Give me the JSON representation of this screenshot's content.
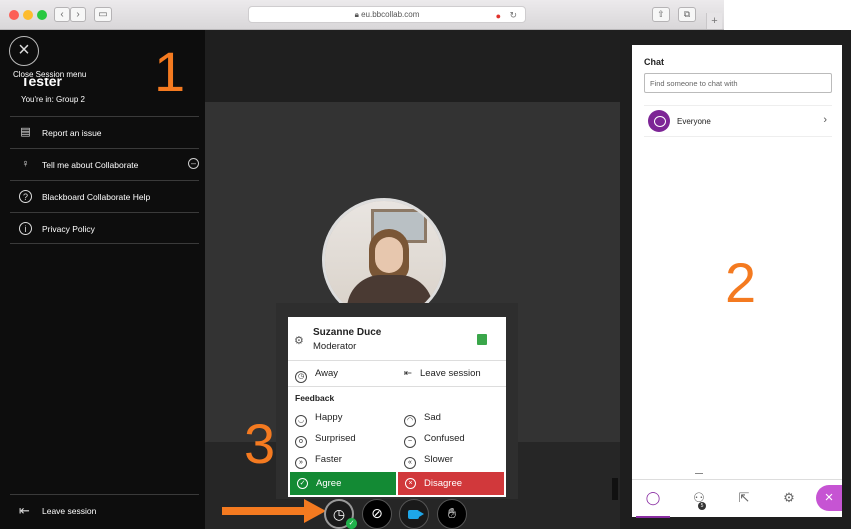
{
  "browser": {
    "url": "eu.bbcollab.com",
    "nav_back": "‹",
    "nav_forward": "›",
    "sidebar_icon": "sidebar-icon",
    "share_icon": "share-icon",
    "tabs_icon": "tabs-icon",
    "new_tab": "+"
  },
  "session_menu": {
    "close_label": "Close Session menu",
    "user_name": "Tester",
    "group": "You're in: Group 2",
    "items": [
      {
        "label": "Report an issue",
        "icon": "report-icon"
      },
      {
        "label": "Tell me about Collaborate",
        "icon": "lightbulb-icon"
      },
      {
        "label": "Blackboard Collaborate Help",
        "icon": "help-icon"
      },
      {
        "label": "Privacy Policy",
        "icon": "info-icon"
      }
    ],
    "leave_label": "Leave session"
  },
  "annotations": {
    "one": "1",
    "two": "2",
    "three": "3"
  },
  "status_popup": {
    "name": "Suzanne Duce",
    "role": "Moderator",
    "away": "Away",
    "leave": "Leave session",
    "feedback_title": "Feedback",
    "feedback": [
      {
        "left": "Happy",
        "right": "Sad"
      },
      {
        "left": "Surprised",
        "right": "Confused"
      },
      {
        "left": "Faster",
        "right": "Slower"
      }
    ],
    "agree": "Agree",
    "disagree": "Disagree",
    "agree_color": "#138a34",
    "disagree_color": "#d1383b"
  },
  "chat": {
    "title": "Chat",
    "search_placeholder": "Find someone to chat with",
    "everyone": "Everyone",
    "attendee_badge": "5"
  },
  "colors": {
    "accent_purple": "#8a2ea3",
    "annotation_orange": "#f47a20"
  }
}
